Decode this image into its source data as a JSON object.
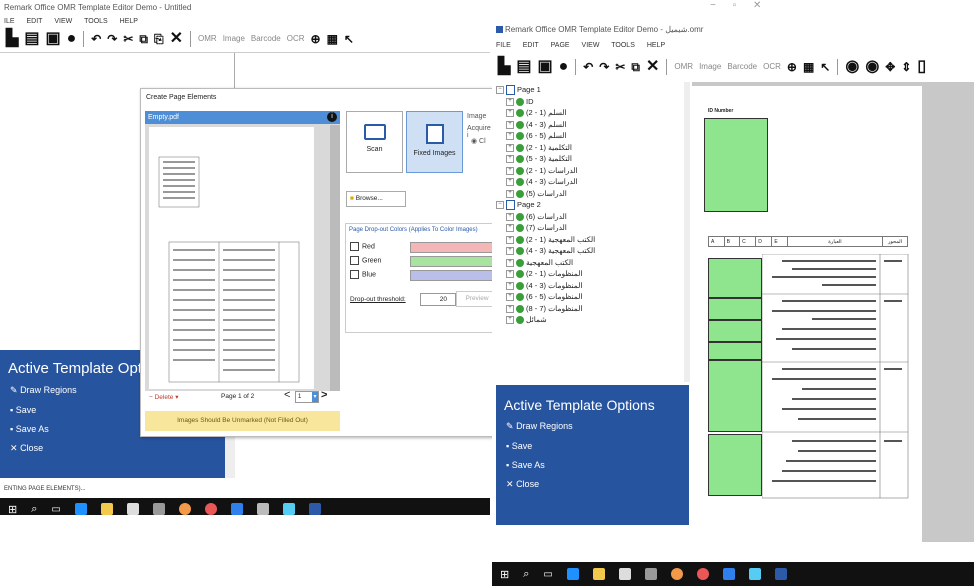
{
  "left_window": {
    "title": "Remark Office OMR Template Editor Demo - Untitled",
    "menu": [
      "ILE",
      "EDIT",
      "VIEW",
      "TOOLS",
      "HELP"
    ],
    "toolbar": {
      "omr": "OMR",
      "image": "Image",
      "barcode": "Barcode",
      "ocr": "OCR"
    },
    "status": "ENTING PAGE ELEMENTS)...",
    "active_template": {
      "title": "Active Template Opt",
      "items": [
        "Draw Regions",
        "Save",
        "Save As",
        "Close"
      ]
    }
  },
  "dialog": {
    "title": "Create Page Elements",
    "file_label": "Empty.pdf",
    "scan_label": "Scan",
    "fixed_images_label": "Fixed Images",
    "image_label": "Image",
    "acquire_label": "Acquire i",
    "browse_label": "Browse...",
    "dropout_title": "Page Drop-out Colors (Applies To Color Images)",
    "colors": [
      "Red",
      "Green",
      "Blue"
    ],
    "threshold_label": "Drop-out threshold:",
    "threshold_value": "20",
    "preview_label": "Preview",
    "delete_label": "Delete",
    "page_label": "Page 1 of 2",
    "page_input": "1",
    "warning": "Images Should Be Unmarked (Not Filled Out)"
  },
  "right_window": {
    "title": "Remark Office OMR Template Editor Demo - شيميل.omr",
    "menu": [
      "FILE",
      "EDIT",
      "PAGE",
      "VIEW",
      "TOOLS",
      "HELP"
    ],
    "toolbar": {
      "omr": "OMR",
      "image": "Image",
      "barcode": "Barcode",
      "ocr": "OCR"
    },
    "tree": [
      {
        "type": "page",
        "label": "Page 1"
      },
      {
        "type": "node",
        "label": "ID"
      },
      {
        "type": "node",
        "label": "السلم (1 - 2)"
      },
      {
        "type": "node",
        "label": "السلم (3 - 4)"
      },
      {
        "type": "node",
        "label": "السلم (5 - 6)"
      },
      {
        "type": "node",
        "label": "التكلمية (1 - 2)"
      },
      {
        "type": "node",
        "label": "التكلمية (3 - 5)"
      },
      {
        "type": "node",
        "label": "الدراسات (1 - 2)"
      },
      {
        "type": "node",
        "label": "الدراسات (3 - 4)"
      },
      {
        "type": "node",
        "label": "الدراسات (5)"
      },
      {
        "type": "page",
        "label": "Page 2"
      },
      {
        "type": "node",
        "label": "الدراسات (6)"
      },
      {
        "type": "node",
        "label": "الدراسات (7)"
      },
      {
        "type": "node",
        "label": "الكتب المعهجية (1 - 2)"
      },
      {
        "type": "node",
        "label": "الكتب المعهجية (3 - 4)"
      },
      {
        "type": "node",
        "label": "الكتب المعهجية"
      },
      {
        "type": "node",
        "label": "المنظومات (1 - 2)"
      },
      {
        "type": "node",
        "label": "المنظومات (3 - 4)"
      },
      {
        "type": "node",
        "label": "المنظومات (5 - 6)"
      },
      {
        "type": "node",
        "label": "المنظومات (7 - 8)"
      },
      {
        "type": "node",
        "label": "شمائل"
      }
    ],
    "active_template": {
      "title": "Active Template Options",
      "items": [
        "Draw Regions",
        "Save",
        "Save As",
        "Close"
      ]
    },
    "doc": {
      "id_label": "ID Number",
      "header_cols": [
        "A",
        "B",
        "C",
        "D",
        "E"
      ],
      "col_question": "العبارة",
      "col_axis": "المحور"
    }
  }
}
